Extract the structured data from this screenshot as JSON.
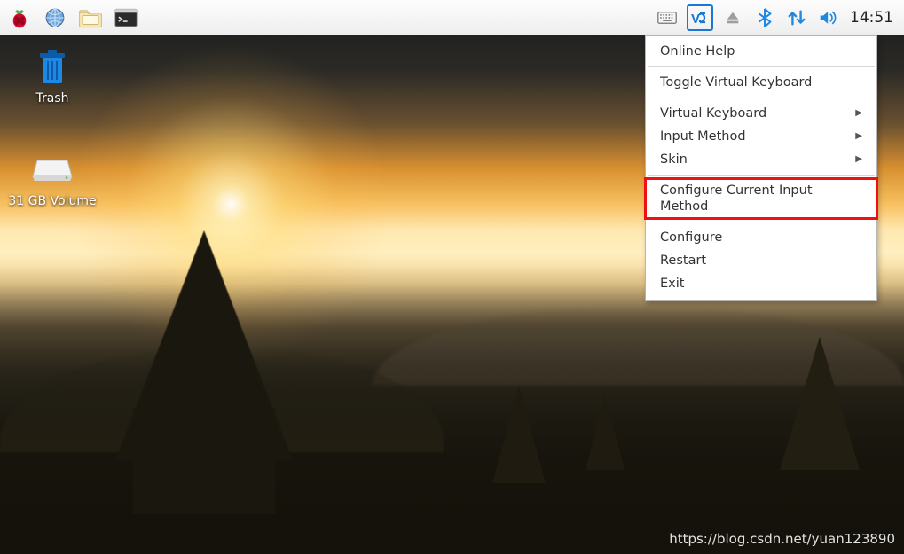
{
  "panel": {
    "launchers": [
      {
        "name": "start-menu",
        "icon": "raspberry"
      },
      {
        "name": "web-browser",
        "icon": "globe"
      },
      {
        "name": "file-manager",
        "icon": "folder"
      },
      {
        "name": "terminal",
        "icon": "terminal"
      }
    ],
    "tray": [
      {
        "name": "keyboard-tray-icon",
        "icon": "keyboard"
      },
      {
        "name": "vnc-tray-icon",
        "icon": "vnc"
      },
      {
        "name": "eject-tray-icon",
        "icon": "eject"
      },
      {
        "name": "bluetooth-tray-icon",
        "icon": "bluetooth"
      },
      {
        "name": "network-tray-icon",
        "icon": "updown"
      },
      {
        "name": "volume-tray-icon",
        "icon": "volume"
      }
    ],
    "clock": "14:51"
  },
  "desktop_icons": {
    "trash": {
      "label": "Trash"
    },
    "volume": {
      "label": "31 GB Volume"
    }
  },
  "context_menu": {
    "items": [
      {
        "label": "Online Help",
        "submenu": false,
        "highlight": false,
        "sep_after": true
      },
      {
        "label": "Toggle Virtual Keyboard",
        "submenu": false,
        "highlight": false,
        "sep_after": true
      },
      {
        "label": "Virtual Keyboard",
        "submenu": true,
        "highlight": false,
        "sep_after": false
      },
      {
        "label": "Input Method",
        "submenu": true,
        "highlight": false,
        "sep_after": false
      },
      {
        "label": "Skin",
        "submenu": true,
        "highlight": false,
        "sep_after": true
      },
      {
        "label": "Configure Current Input Method",
        "submenu": false,
        "highlight": true,
        "sep_after": true
      },
      {
        "label": "Configure",
        "submenu": false,
        "highlight": false,
        "sep_after": false
      },
      {
        "label": "Restart",
        "submenu": false,
        "highlight": false,
        "sep_after": false
      },
      {
        "label": "Exit",
        "submenu": false,
        "highlight": false,
        "sep_after": false
      }
    ]
  },
  "watermark": "https://blog.csdn.net/yuan123890",
  "colors": {
    "accent_blue": "#1e88e5",
    "highlight_red": "#e11111",
    "panel_bg": "#f2f2f2"
  }
}
